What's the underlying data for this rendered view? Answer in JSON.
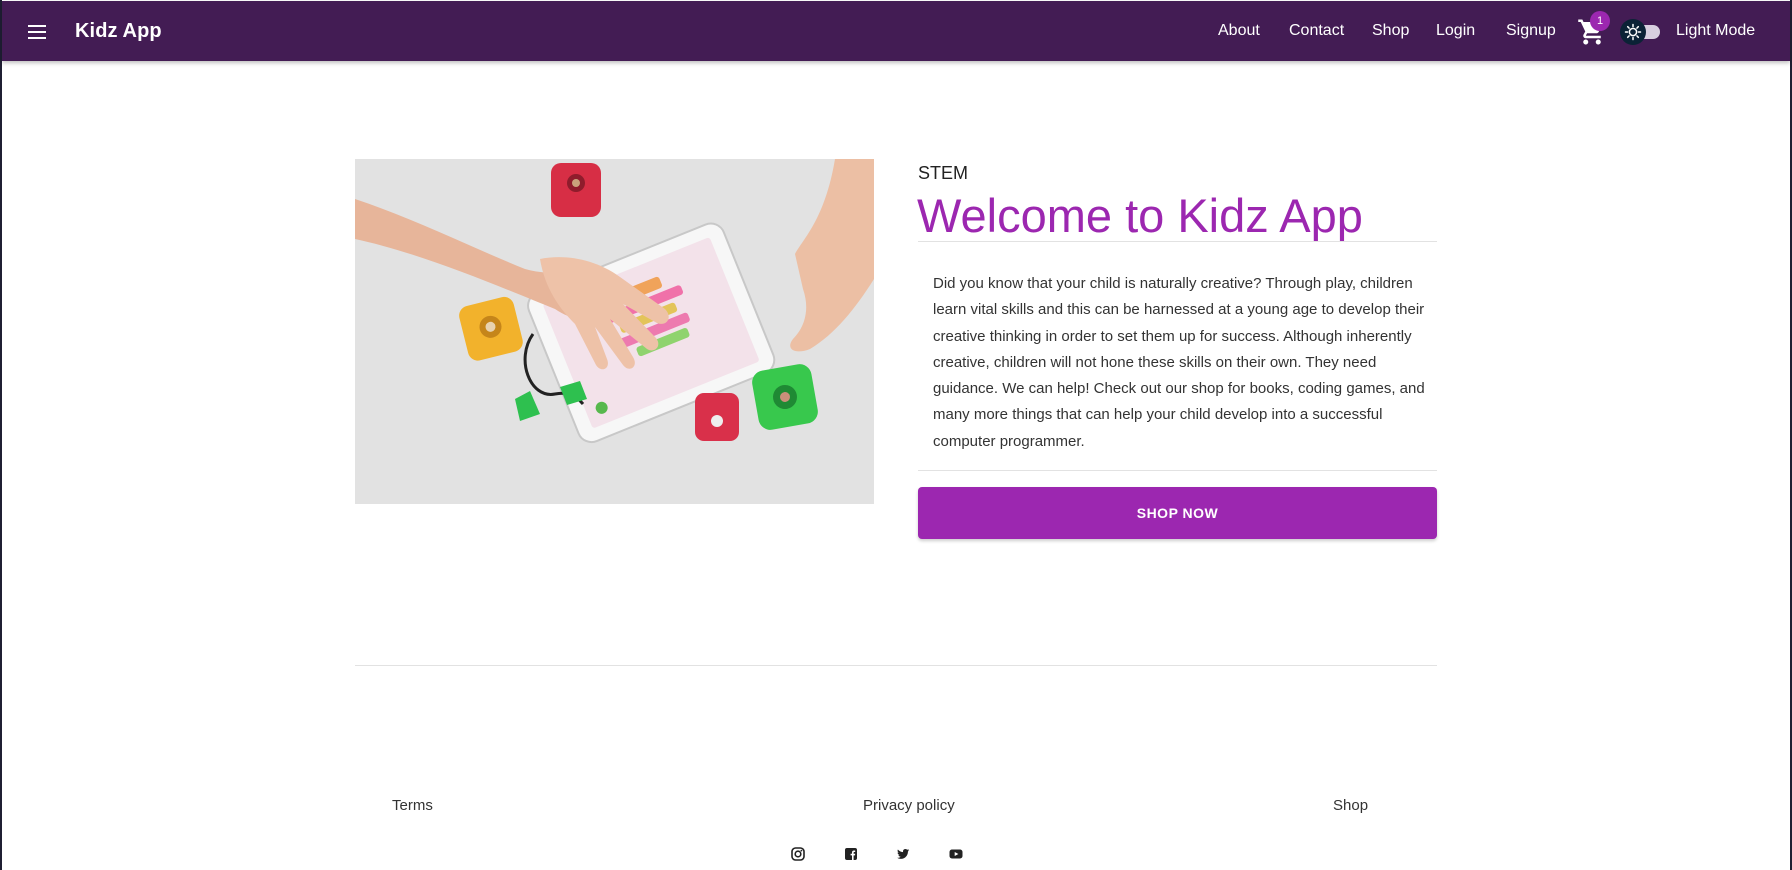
{
  "appbar": {
    "brand": "Kidz App",
    "nav": [
      "About",
      "Contact",
      "Shop",
      "Login",
      "Signup"
    ],
    "cart_count": "1",
    "mode_label": "Light Mode",
    "background": "#431c54"
  },
  "hero": {
    "image_alt": "Child coding on a tablet surrounded by colorful robot cubes",
    "overline": "STEM",
    "title": "Welcome to Kidz App",
    "body": "Did you know that your child is naturally creative? Through play, children learn vital skills and this can be harnessed at a young age to develop their creative thinking in order to set them up for success. Although inherently creative, children will not hone these skills on their own. They need guidance. We can help! Check out our shop for books, coding games, and many more things that can help your child develop into a successful computer programmer.",
    "button_label": "SHOP NOW",
    "accent": "#9c27b0"
  },
  "footer": {
    "links": [
      "Terms",
      "Privacy policy",
      "Shop"
    ],
    "social_icons": [
      "instagram-icon",
      "facebook-icon",
      "twitter-icon",
      "youtube-icon"
    ]
  }
}
